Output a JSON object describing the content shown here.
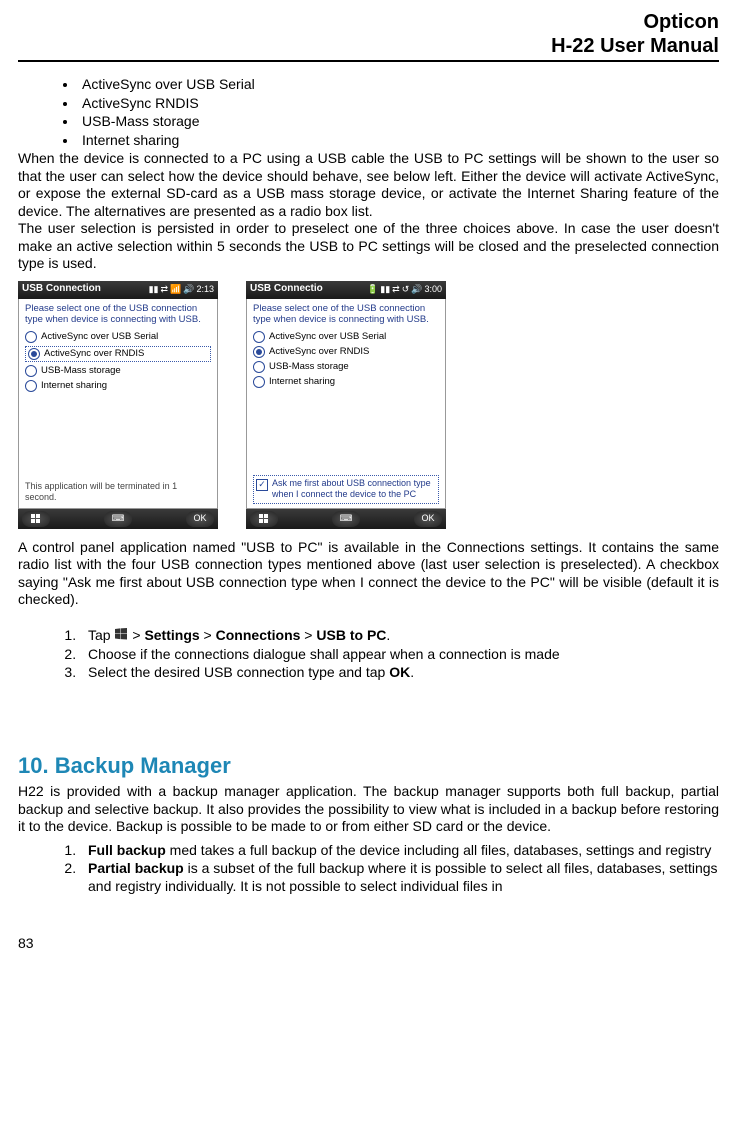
{
  "header": {
    "line1": "Opticon",
    "line2": "H-22 User Manual"
  },
  "bullets": [
    "ActiveSync over USB Serial",
    "ActiveSync RNDIS",
    "USB-Mass storage",
    "Internet sharing"
  ],
  "para1": "When the device is connected to a PC using a USB cable the USB to PC settings will be shown to the user so that the user can select how the device should behave, see below left. Either the device will activate ActiveSync, or expose the external SD-card as a USB mass storage device, or activate the Internet Sharing feature of the device. The alternatives are presented as a radio box list.",
  "para2": "The user selection is persisted in order to preselect one of the three choices above. In case the user doesn't make an active selection within 5 seconds the USB to PC settings will be closed and the preselected connection type is used.",
  "shot1": {
    "title": "USB Connection",
    "time": "2:13",
    "instr": "Please select one of the USB connection type when device is connecting with USB.",
    "options": [
      "ActiveSync over USB Serial",
      "ActiveSync over RNDIS",
      "USB-Mass storage",
      "Internet sharing"
    ],
    "selected": 1,
    "footer": "This application will be terminated in  1 second.",
    "ok": "OK"
  },
  "shot2": {
    "title": "USB Connectio",
    "time": "3:00",
    "instr": "Please select one of the USB connection type when device is connecting with USB.",
    "options": [
      "ActiveSync over USB Serial",
      "ActiveSync over RNDIS",
      "USB-Mass storage",
      "Internet sharing"
    ],
    "selected": 1,
    "checkbox": "Ask me first about USB connection type when I connect the device to the PC",
    "ok": "OK"
  },
  "para3": "A control panel application named \"USB to PC\" is available in the Connections settings. It contains the same radio list with the four USB connection types mentioned above (last user selection is preselected). A checkbox saying \"Ask me first about USB connection type when I connect the device to the PC\" will be visible (default it is checked).",
  "steps": {
    "s1a": "Tap ",
    "s1b": " > ",
    "s1_settings": "Settings",
    "s1c": " > ",
    "s1_conn": "Connections",
    "s1d": " > ",
    "s1_usb": "USB to PC",
    "s1e": ".",
    "s2": "Choose if the connections dialogue shall appear when a connection is made",
    "s3a": "Select the desired USB connection type and tap ",
    "s3_ok": "OK",
    "s3b": "."
  },
  "section": {
    "num": "10.",
    "title": "Backup Manager"
  },
  "para4": "H22 is provided with a backup manager application. The backup manager supports both full backup, partial backup and selective backup. It also provides the possibility to view what is included in a backup before restoring it to the device. Backup is possible to be made to or from either SD card or the device.",
  "backup": {
    "b1_bold": "Full backup",
    "b1_rest": " med takes a full backup of the device including all files, databases, settings and registry",
    "b2_bold": "Partial backup",
    "b2_rest": " is a subset of the full backup where it is possible to select all files, databases, settings and registry individually. It is not possible to select individual files in"
  },
  "pagenum": "83"
}
